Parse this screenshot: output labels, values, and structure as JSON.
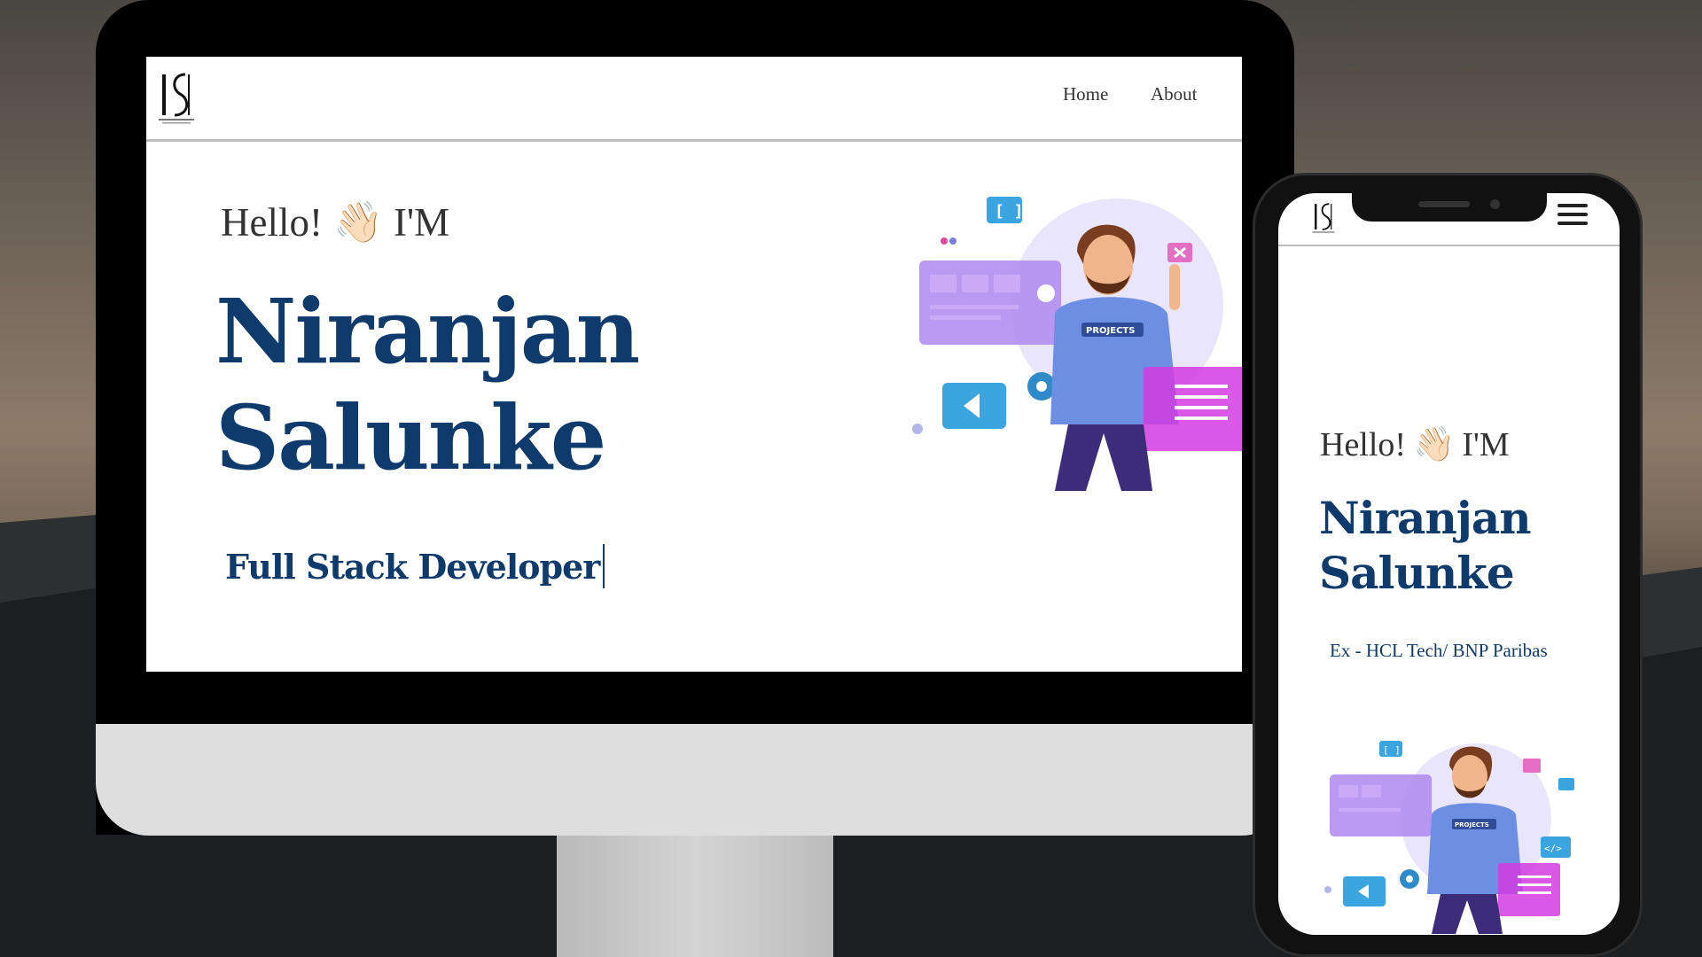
{
  "desktop": {
    "nav": {
      "home_label": "Home",
      "about_label": "About"
    },
    "hero": {
      "greeting_prefix": "Hello!",
      "greeting_emoji": "👋🏻",
      "greeting_suffix": "I'M",
      "name_line1": "Niranjan",
      "name_line2": "Salunke",
      "role": "Full Stack Developer"
    },
    "illustration_badge": "PROJECTS"
  },
  "mobile": {
    "hero": {
      "greeting_prefix": "Hello!",
      "greeting_emoji": "👋🏻",
      "greeting_suffix": "I'M",
      "name_line1": "Niranjan",
      "name_line2": "Salunke",
      "subtitle": "Ex - HCL Tech/ BNP Paribas"
    },
    "illustration_badge": "PROJECTS"
  },
  "colors": {
    "accent": "#0e3b6c",
    "illustration_purple": "#9b7bea",
    "illustration_magenta": "#d23be0",
    "illustration_blue": "#3aa5e0"
  },
  "icons": [
    "logo-icon",
    "wave-hand-icon",
    "hamburger-menu-icon"
  ]
}
